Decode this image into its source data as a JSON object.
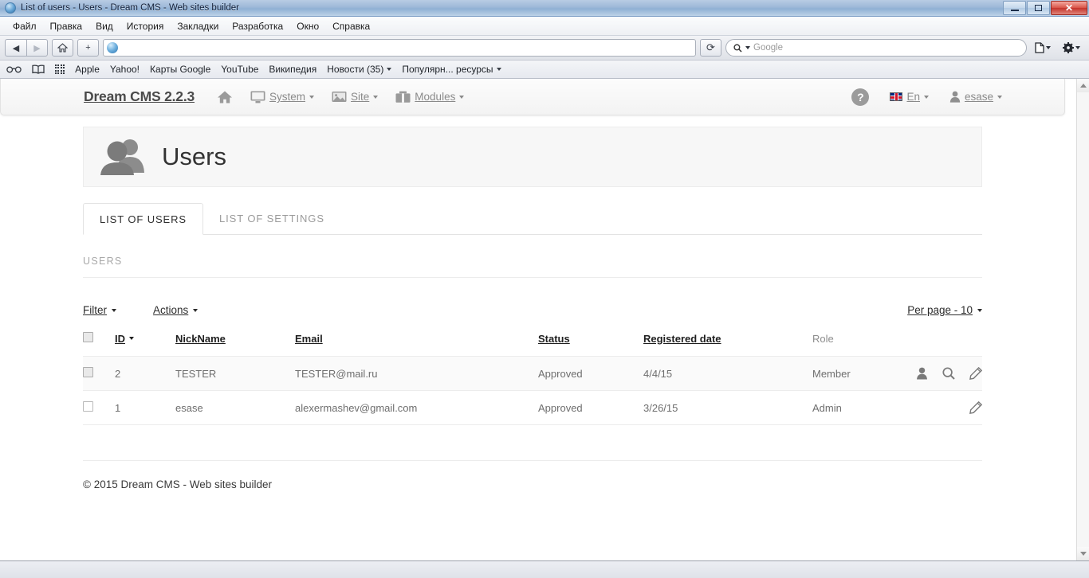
{
  "window": {
    "title": "List of users - Users - Dream CMS - Web sites builder",
    "favicon": "globe-icon",
    "minimize_label": "Minimize",
    "maximize_label": "Restore",
    "close_label": "✕"
  },
  "menubar": {
    "items": [
      "Файл",
      "Правка",
      "Вид",
      "История",
      "Закладки",
      "Разработка",
      "Окно",
      "Справка"
    ]
  },
  "toolbar": {
    "back": "◀",
    "forward": "▶",
    "home": "⌂",
    "new_tab": "+",
    "url": "",
    "reload": "⟳",
    "search_placeholder": "Google",
    "search_icon": "magnifier-icon",
    "reader_icon": "page-icon",
    "settings_icon": "gear-icon"
  },
  "bookmarks": {
    "icons": [
      "glasses-icon",
      "book-icon",
      "grid-dots-icon"
    ],
    "items": [
      {
        "label": "Apple",
        "dropdown": false
      },
      {
        "label": "Yahoo!",
        "dropdown": false
      },
      {
        "label": "Карты Google",
        "dropdown": false
      },
      {
        "label": "YouTube",
        "dropdown": false
      },
      {
        "label": "Википедия",
        "dropdown": false
      },
      {
        "label": "Новости (35)",
        "dropdown": true
      },
      {
        "label": "Популярн... ресурсы",
        "dropdown": true
      }
    ]
  },
  "cms_header": {
    "brand": "Dream CMS 2.2.3",
    "home_icon": "home-icon",
    "nav": [
      {
        "label": "System",
        "icon": "monitor-icon"
      },
      {
        "label": "Site",
        "icon": "image-icon"
      },
      {
        "label": "Modules",
        "icon": "briefcase-icon"
      }
    ],
    "help_icon": "question-mark-icon",
    "language": "En",
    "language_flag": "uk-flag-icon",
    "user": "esase",
    "user_icon": "person-icon"
  },
  "page": {
    "title": "Users",
    "title_icon": "users-group-icon",
    "tabs": [
      {
        "label": "LIST OF USERS",
        "active": true
      },
      {
        "label": "LIST OF SETTINGS",
        "active": false
      }
    ],
    "section_label": "USERS"
  },
  "table_toolbar": {
    "filter": "Filter",
    "actions": "Actions",
    "per_page": "Per page - 10"
  },
  "table": {
    "columns": [
      {
        "key": "check",
        "label": "",
        "sortable": false
      },
      {
        "key": "id",
        "label": "ID",
        "sortable": true,
        "sorted": true
      },
      {
        "key": "nickname",
        "label": "NickName",
        "sortable": true
      },
      {
        "key": "email",
        "label": "Email",
        "sortable": true
      },
      {
        "key": "status",
        "label": "Status",
        "sortable": true
      },
      {
        "key": "registered",
        "label": "Registered date",
        "sortable": true
      },
      {
        "key": "role",
        "label": "Role",
        "sortable": false
      },
      {
        "key": "actions",
        "label": "",
        "sortable": false
      }
    ],
    "rows": [
      {
        "id": "2",
        "nickname": "TESTER",
        "email": "TESTER@mail.ru",
        "status": "Approved",
        "registered": "4/4/15",
        "role": "Member",
        "checked": false,
        "hovered": true,
        "actions": [
          "person-icon",
          "magnifier-icon",
          "pencil-icon"
        ]
      },
      {
        "id": "1",
        "nickname": "esase",
        "email": "alexermashev@gmail.com",
        "status": "Approved",
        "registered": "3/26/15",
        "role": "Admin",
        "checked": false,
        "hovered": false,
        "actions": [
          "pencil-icon"
        ]
      }
    ]
  },
  "footer": {
    "copyright": "© 2015 Dream CMS - Web sites builder"
  },
  "colors": {
    "accent": "#4a4a4a",
    "text": "#2c2c2c",
    "muted": "#8d8d8d",
    "border": "#ececec",
    "title_bar": "#9db8d8",
    "close_button": "#c4342c"
  }
}
